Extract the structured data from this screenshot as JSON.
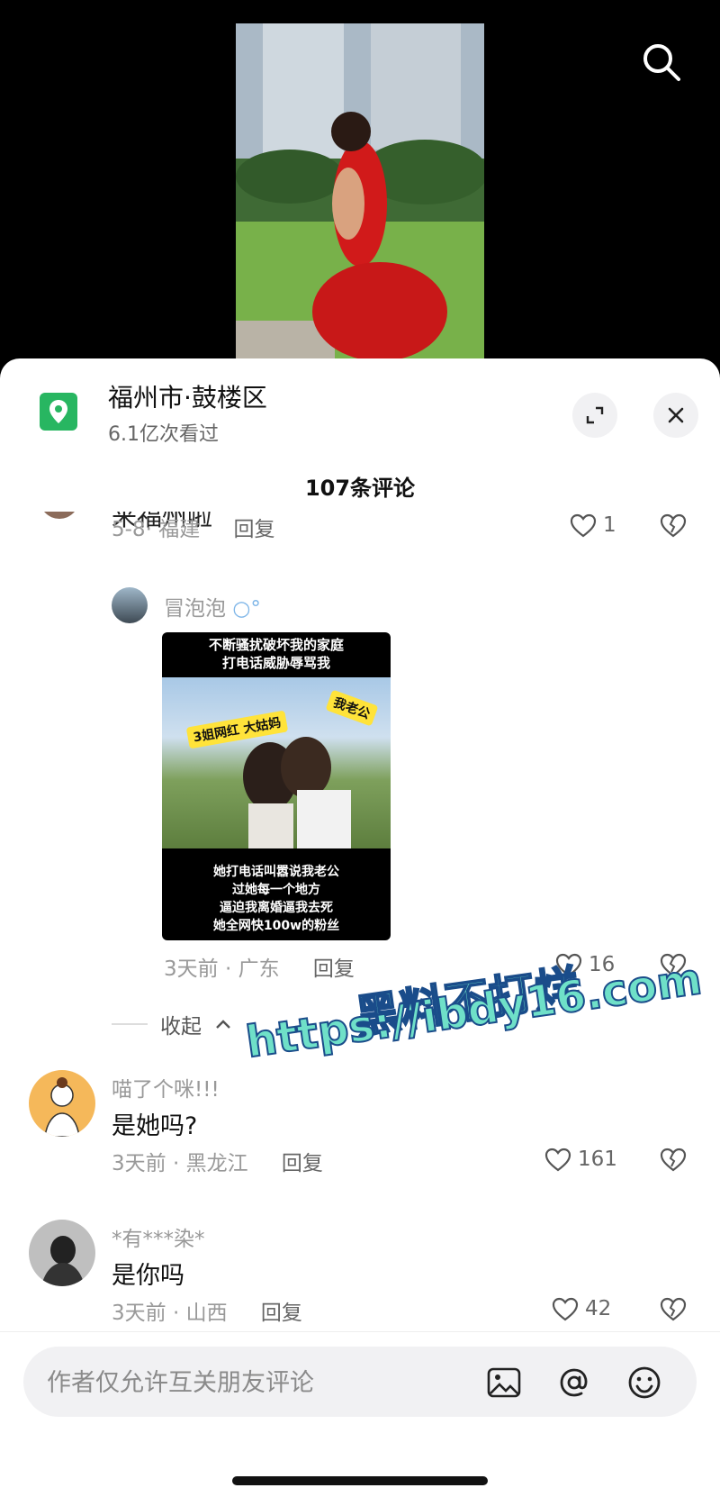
{
  "header": {
    "location_title": "福州市·鼓楼区",
    "views": "6.1亿次看过",
    "comment_count": "107条评论"
  },
  "comments": {
    "partial": {
      "text": "来福州啦",
      "date_place": "5-8· 福建",
      "reply": "回复",
      "likes": "1"
    },
    "reply1": {
      "username": "冒泡泡",
      "thumb_top": "不断骚扰破坏我的家庭\n打电话威胁辱骂我",
      "thumb_tag1": "3姐网红 大姑妈",
      "thumb_tag2": "我老公",
      "thumb_bottom": "她打电话叫嚣说我老公\n过她每一个地方\n逼迫我离婚逼我去死\n她全网快100w的粉丝",
      "date_place": "3天前 · 广东",
      "reply": "回复",
      "likes": "16"
    },
    "collapse": "收起",
    "c2": {
      "username": "喵了个咪!!!",
      "text": "是她吗?",
      "date_place": "3天前 · 黑龙江",
      "reply": "回复",
      "likes": "161"
    },
    "c3": {
      "username": "*有***染*",
      "text": "是你吗",
      "date_place": "3天前 · 山西",
      "reply": "回复",
      "likes": "42"
    }
  },
  "watermark": {
    "line1": "黑料不打烊",
    "line2": "https://ibdy16.com"
  },
  "input": {
    "placeholder": "作者仅允许互关朋友评论"
  }
}
